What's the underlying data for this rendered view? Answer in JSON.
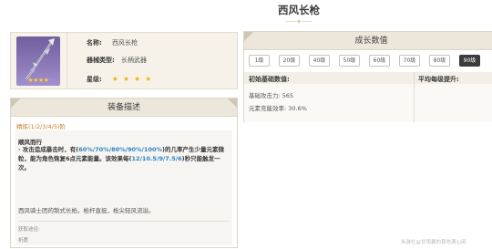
{
  "weapon": {
    "title": "西风长枪",
    "icon": "polearm-weapon-icon",
    "icon_stars": "★★★★"
  },
  "info": {
    "name_label": "名称:",
    "name_value": "西风长枪",
    "type_label": "器械类型:",
    "type_value": "长柄武器",
    "rarity_label": "星级:",
    "rarity_value": "★ ★ ★ ★"
  },
  "description": {
    "header": "装备描述",
    "refinement": "精炼(1/2/3/4/5)阶",
    "passive_name": "顺风而行",
    "passive_t1": "· 攻击造成暴击时，有(",
    "passive_h1": "60%/70%/80%/90%/100%",
    "passive_t2": ")的几率产生少量元素微粒，能为角色恢复6点元素能量。该效果每(",
    "passive_h2": "12/10.5/9/7.5/6",
    "passive_t3": ")秒只能触发一次。",
    "flavor": "西风骑士团的制式长枪。枪杆直挺，枪尖轻风流溢。",
    "obtain_label": "获取途径:",
    "obtain_value": "祈愿"
  },
  "growth": {
    "header": "成长数值",
    "levels": [
      "1级",
      "20级",
      "40级",
      "50级",
      "60级",
      "70级",
      "80级",
      "90级"
    ],
    "active_level": "90级",
    "col_initial": "初始基础数值:",
    "col_avg": "平均每级提升:",
    "atk_label": "基础攻击力:",
    "atk_value": "565",
    "er_label": "元素充能效率:",
    "er_value": "30.6%"
  },
  "watermark": "米游社@甘雨暴的喜吃满心闲",
  "colors": {
    "accent_highlight": "#2a83c9",
    "refinement_text": "#c67d2c",
    "star_gold": "#f0b400",
    "panel_header_bg": "#ece6db",
    "active_level_bg": "#3b3b3b"
  }
}
